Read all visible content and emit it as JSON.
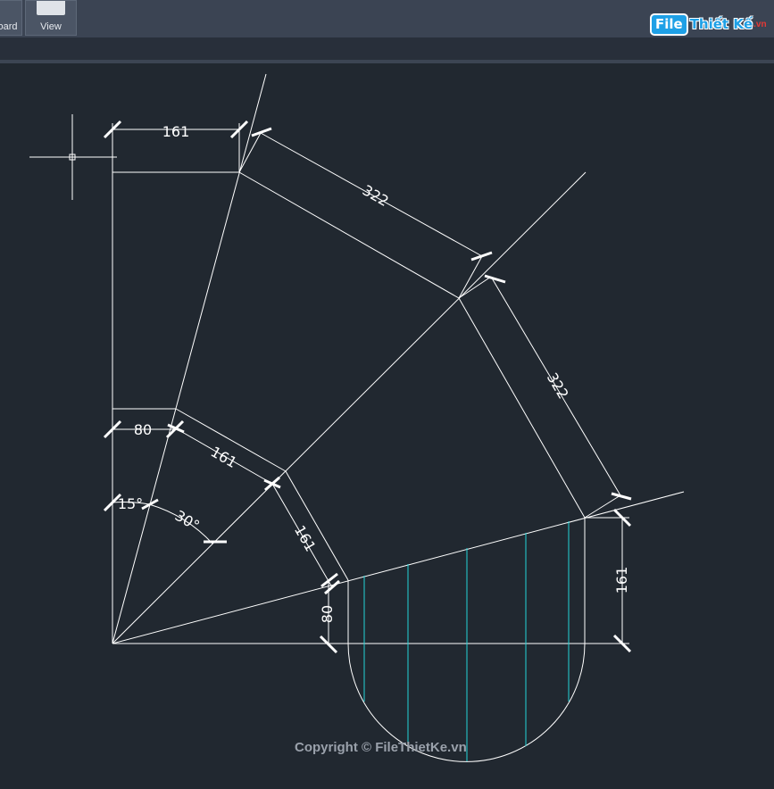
{
  "ribbon": {
    "clipboard_label": "oard",
    "view_label": "View"
  },
  "logo": {
    "file": "File",
    "thiet_ke": "Thiết Kế",
    "vn": ".vn"
  },
  "dimensions": {
    "top_161": "161",
    "diag_322_a": "322",
    "diag_322_b": "322",
    "left_80": "80",
    "mid_161_a": "161",
    "mid_161_b": "161",
    "angle_15": "15°",
    "angle_30": "30°",
    "bottom_80": "80",
    "right_161": "161"
  },
  "copyright": "Copyright © FileThietKe.vn",
  "colors": {
    "background": "#212830",
    "line": "#ffffff",
    "hatch": "#22d3d8"
  }
}
